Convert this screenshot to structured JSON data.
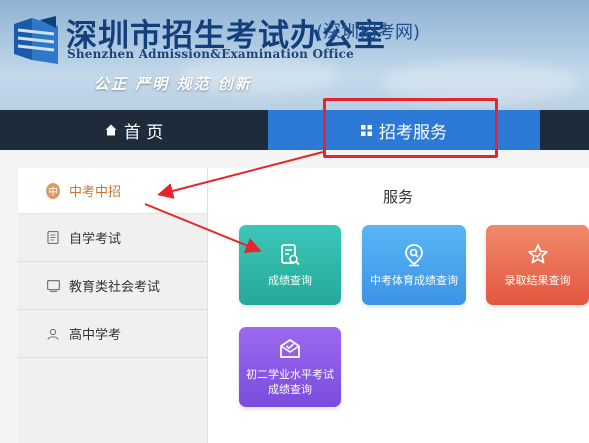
{
  "header": {
    "title": "深圳市招生考试办公室",
    "subtitle": "(深圳招考网)",
    "english_name": "Shenzhen Admission&Examination Office",
    "motto": "公正 严明 规范 创新",
    "logo_icon": "shield-book-logo"
  },
  "nav": {
    "items": [
      {
        "label": "首 页",
        "icon": "home-icon"
      },
      {
        "label": "招考服务",
        "icon": "grid-icon"
      }
    ],
    "active_index": 1
  },
  "sidebar": {
    "items": [
      {
        "label": "中考中招",
        "icon": "zhong-badge-icon"
      },
      {
        "label": "自学考试",
        "icon": "book-icon"
      },
      {
        "label": "教育类社会考试",
        "icon": "certificate-icon"
      },
      {
        "label": "高中学考",
        "icon": "user-icon"
      }
    ],
    "active_index": 0
  },
  "main": {
    "title": "服务",
    "tiles": [
      {
        "label": "成绩查询",
        "icon": "document-search-icon",
        "color": "#2bb5a6"
      },
      {
        "label": "中考体育成绩查询",
        "icon": "location-search-icon",
        "color": "#45a3ee"
      },
      {
        "label": "录取结果查询",
        "icon": "star-badge-icon",
        "color": "#e86a4f"
      },
      {
        "label_line1": "初二学业水平考试",
        "label_line2": "成绩查询",
        "icon": "envelope-check-icon",
        "color": "#8a5ae6"
      }
    ]
  },
  "colors": {
    "nav_bg": "#1e2b3a",
    "nav_active": "#2d7ad6",
    "highlight": "#e5242b",
    "active_sidebar_text": "#c6743a"
  }
}
